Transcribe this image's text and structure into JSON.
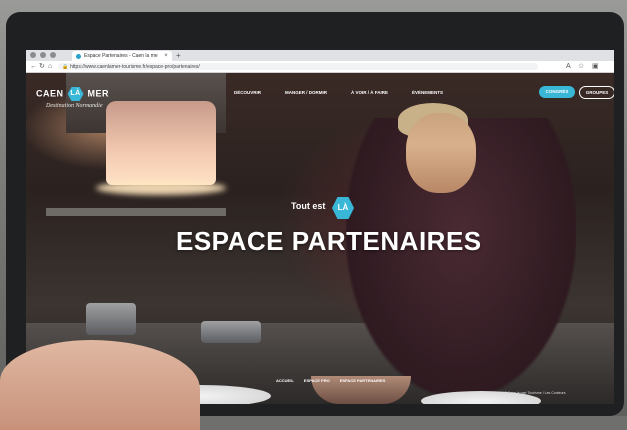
{
  "browser": {
    "tab_title": "Espace Partenaires - Caen la me",
    "url": "https://www.caenlamer-tourisme.fr/espace-pro/partenaires/"
  },
  "site": {
    "logo_left": "CAEN",
    "logo_hex": "LÀ",
    "logo_right": "MER",
    "logo_tagline": "Destination Normandie",
    "menu": [
      "DÉCOUVRIR",
      "MANGER / DORMIR",
      "À VOIR / À FAIRE",
      "ÉVÉNEMENTS"
    ],
    "btn_conges": "CONGRÈS",
    "btn_groupes": "GROUPES",
    "accent_color": "#39b7d6"
  },
  "hero": {
    "tagline": "Tout est",
    "tag_hex": "LÀ",
    "title": "ESPACE PARTENAIRES"
  },
  "breadcrumb": [
    "ACCUEIL",
    "ESPACE PRO",
    "ESPACE PARTENAIRES"
  ],
  "photo_credit": "@Caen la mer Tourisme / Les Conteurs"
}
